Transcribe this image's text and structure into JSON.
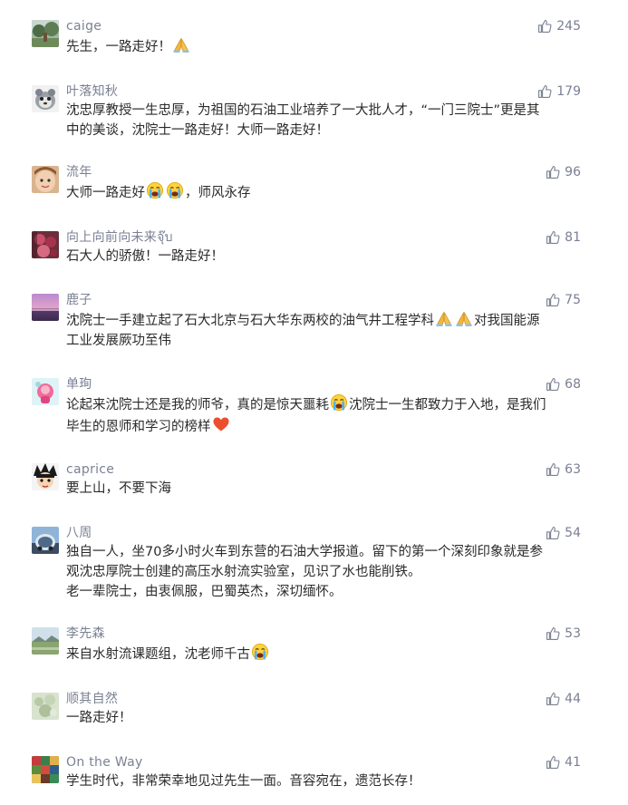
{
  "comments": [
    {
      "nickname": "caige",
      "likes": "245",
      "avatar": "avatar-garden",
      "lines": [
        [
          {
            "t": "text",
            "v": "先生，一路走好！"
          },
          {
            "t": "emoji",
            "v": "folded-hands-emoji"
          }
        ]
      ]
    },
    {
      "nickname": "叶落知秋",
      "likes": "179",
      "avatar": "avatar-cartoon",
      "lines": [
        [
          {
            "t": "text",
            "v": "沈忠厚教授一生忠厚，为祖国的石油工业培养了一大批人才，“一门三院士”更是其"
          }
        ],
        [
          {
            "t": "text",
            "v": "中的美谈，沈院士一路走好！大师一路走好！"
          }
        ]
      ]
    },
    {
      "nickname": "流年",
      "likes": "96",
      "avatar": "avatar-child",
      "lines": [
        [
          {
            "t": "text",
            "v": "大师一路走好"
          },
          {
            "t": "emoji",
            "v": "crying-face-emoji"
          },
          {
            "t": "emoji",
            "v": "crying-face-emoji"
          },
          {
            "t": "text",
            "v": "，师风永存"
          }
        ]
      ]
    },
    {
      "nickname": "向上向前向未来จุ๊บ",
      "likes": "81",
      "avatar": "avatar-flowers",
      "lines": [
        [
          {
            "t": "text",
            "v": "石大人的骄傲！一路走好！"
          }
        ]
      ]
    },
    {
      "nickname": "鹿子",
      "likes": "75",
      "avatar": "avatar-sunset",
      "lines": [
        [
          {
            "t": "text",
            "v": "沈院士一手建立起了石大北京与石大华东两校的油气井工程学科"
          },
          {
            "t": "emoji",
            "v": "folded-hands-emoji"
          },
          {
            "t": "emoji",
            "v": "folded-hands-emoji"
          },
          {
            "t": "text",
            "v": "对我国能源"
          }
        ],
        [
          {
            "t": "text",
            "v": "工业发展厥功至伟"
          }
        ]
      ]
    },
    {
      "nickname": "单珣",
      "likes": "68",
      "avatar": "avatar-pink",
      "lines": [
        [
          {
            "t": "text",
            "v": "论起来沈院士还是我的师爷，真的是惊天噩耗"
          },
          {
            "t": "emoji",
            "v": "crying-face-emoji"
          },
          {
            "t": "text",
            "v": "沈院士一生都致力于入地，是我们"
          }
        ],
        [
          {
            "t": "text",
            "v": "毕生的恩师和学习的榜样"
          },
          {
            "t": "emoji",
            "v": "red-heart-emoji"
          }
        ]
      ]
    },
    {
      "nickname": "caprice",
      "likes": "63",
      "avatar": "avatar-anime",
      "lines": [
        [
          {
            "t": "text",
            "v": "要上山，不要下海"
          }
        ]
      ]
    },
    {
      "nickname": "八周",
      "likes": "54",
      "avatar": "avatar-car",
      "lines": [
        [
          {
            "t": "text",
            "v": "独自一人，坐70多小时火车到东营的石油大学报道。留下的第一个深刻印象就是参"
          }
        ],
        [
          {
            "t": "text",
            "v": "观沈忠厚院士创建的高压水射流实验室，见识了水也能削铁。"
          }
        ],
        [
          {
            "t": "text",
            "v": "老一辈院士，由衷佩服，巴蜀英杰，深切缅怀。"
          }
        ]
      ]
    },
    {
      "nickname": "李先森",
      "likes": "53",
      "avatar": "avatar-landscape",
      "lines": [
        [
          {
            "t": "text",
            "v": "来自水射流课题组，沈老师千古"
          },
          {
            "t": "emoji",
            "v": "crying-face-emoji"
          }
        ]
      ]
    },
    {
      "nickname": "顺其自然",
      "likes": "44",
      "avatar": "avatar-blossom",
      "lines": [
        [
          {
            "t": "text",
            "v": "一路走好！"
          }
        ]
      ]
    },
    {
      "nickname": "On the Way",
      "likes": "41",
      "avatar": "avatar-mosaic",
      "lines": [
        [
          {
            "t": "text",
            "v": "学生时代，非常荣幸地见过先生一面。音容宛在，遗范长存！"
          }
        ]
      ]
    }
  ]
}
